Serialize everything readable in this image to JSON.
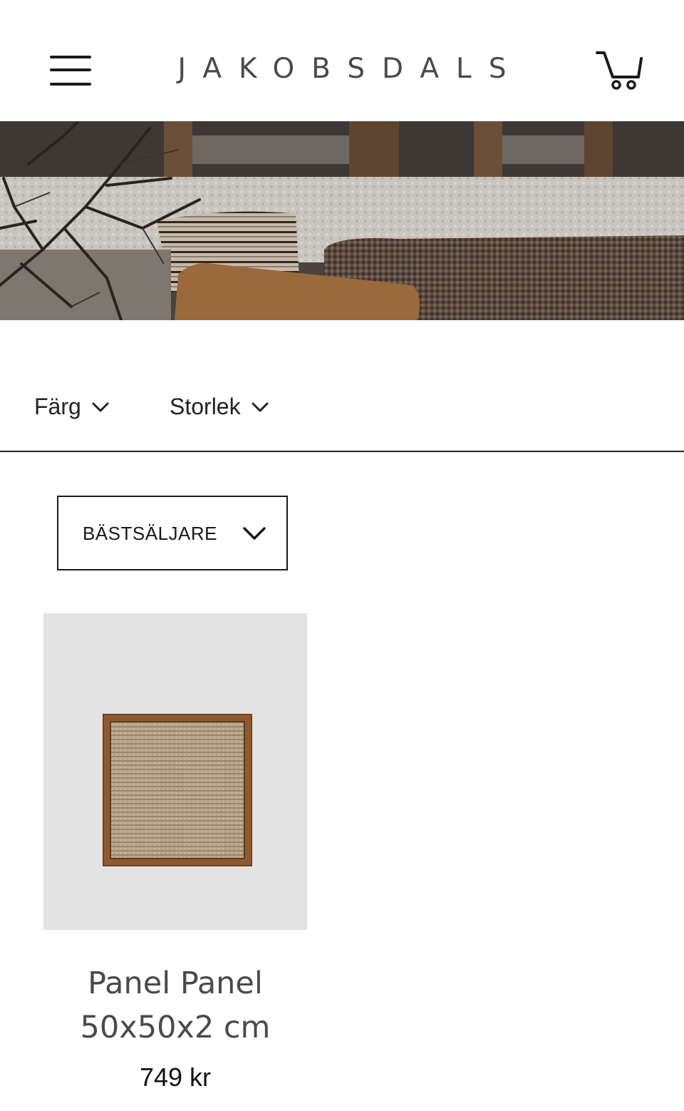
{
  "header": {
    "logo": "JAKOBSDALS",
    "menu_icon": "hamburger-menu-icon",
    "cart_icon": "shopping-cart-icon"
  },
  "hero": {
    "image": "lifestyle photo of sofa with woven cushions and branches"
  },
  "filters": {
    "color_label": "Färg",
    "size_label": "Storlek"
  },
  "sort": {
    "selected": "BÄSTSÄLJARE"
  },
  "products": [
    {
      "title_line1": "Panel Panel",
      "title_line2": "50x50x2 cm",
      "price": "749 kr",
      "image": "square woven panel in wooden frame"
    }
  ],
  "colors": {
    "text_dark": "#1a1a1a",
    "logo_gray": "#4a4a48",
    "product_bg": "#e3e3e3"
  }
}
